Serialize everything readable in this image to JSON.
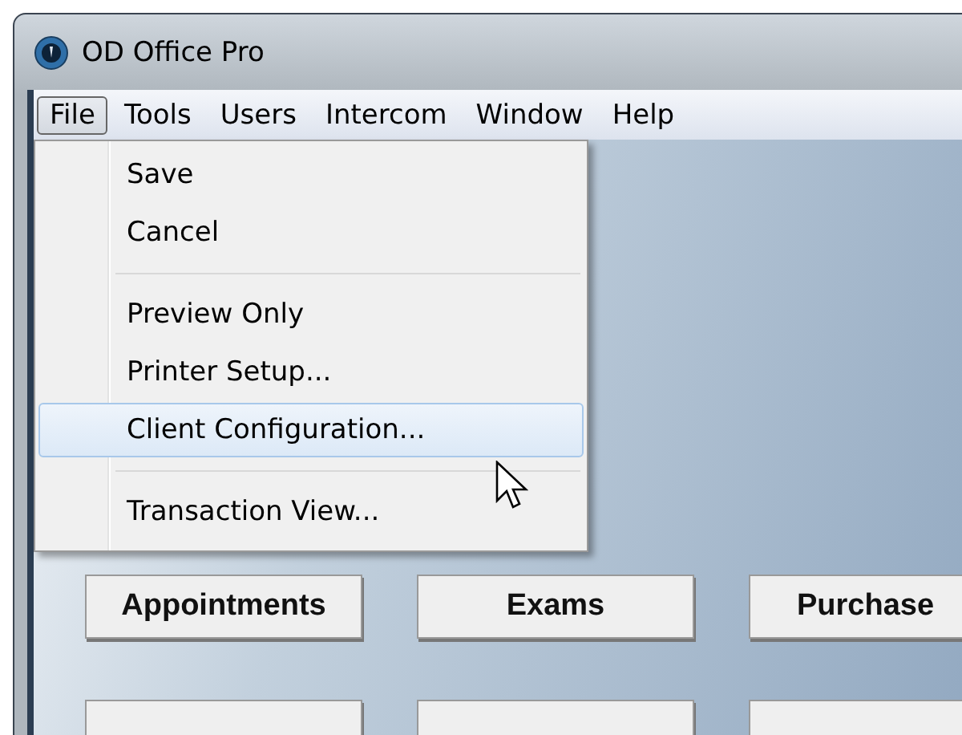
{
  "window": {
    "title": "OD Office Pro"
  },
  "menu_bar": [
    {
      "label": "File",
      "selected": true
    },
    {
      "label": "Tools",
      "selected": false
    },
    {
      "label": "Users",
      "selected": false
    },
    {
      "label": "Intercom",
      "selected": false
    },
    {
      "label": "Window",
      "selected": false
    },
    {
      "label": "Help",
      "selected": false
    }
  ],
  "file_menu": [
    {
      "kind": "item",
      "label": "Save",
      "selected": false
    },
    {
      "kind": "item",
      "label": "Cancel",
      "selected": false
    },
    {
      "kind": "separator"
    },
    {
      "kind": "item",
      "label": "Preview Only",
      "selected": false
    },
    {
      "kind": "item",
      "label": "Printer Setup...",
      "selected": false
    },
    {
      "kind": "item",
      "label": "Client Configuration...",
      "selected": true
    },
    {
      "kind": "separator"
    },
    {
      "kind": "item",
      "label": "Transaction View...",
      "selected": false
    }
  ],
  "buttons": [
    "Appointments",
    "Exams",
    "Purchase"
  ]
}
